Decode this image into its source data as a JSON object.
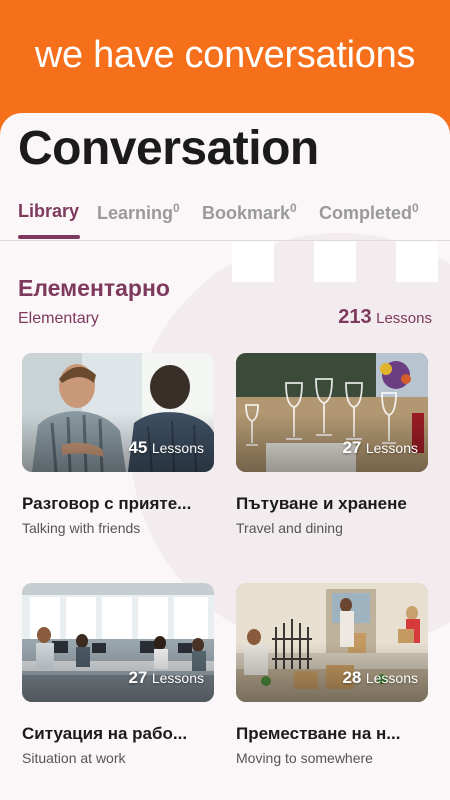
{
  "banner": {
    "text": "we have conversations"
  },
  "page": {
    "title": "Conversation"
  },
  "tabs": [
    {
      "label": "Library",
      "count": ""
    },
    {
      "label": "Learning",
      "count": "0"
    },
    {
      "label": "Bookmark",
      "count": "0"
    },
    {
      "label": "Completed",
      "count": "0"
    }
  ],
  "level": {
    "title": "Елементарно",
    "subtitle": "Elementary",
    "count": "213",
    "count_label": "Lessons"
  },
  "courses": [
    {
      "title": "Разговор с прияте...",
      "subtitle": "Talking with friends",
      "lessons": "45",
      "lessons_label": "Lessons",
      "image": "friends-talking-photo"
    },
    {
      "title": "Пътуване и хранене",
      "subtitle": "Travel and dining",
      "lessons": "27",
      "lessons_label": "Lessons",
      "image": "dining-table-photo"
    },
    {
      "title": "Ситуация на рабо...",
      "subtitle": "Situation at work",
      "lessons": "27",
      "lessons_label": "Lessons",
      "image": "office-photo"
    },
    {
      "title": "Преместване на н...",
      "subtitle": "Moving to somewhere",
      "lessons": "28",
      "lessons_label": "Lessons",
      "image": "moving-boxes-photo"
    }
  ],
  "colors": {
    "banner": "#f66f1a",
    "accent": "#7d3a5d",
    "inactive_tab": "#9a9a9a",
    "card_bg": "#fbf6f7"
  }
}
